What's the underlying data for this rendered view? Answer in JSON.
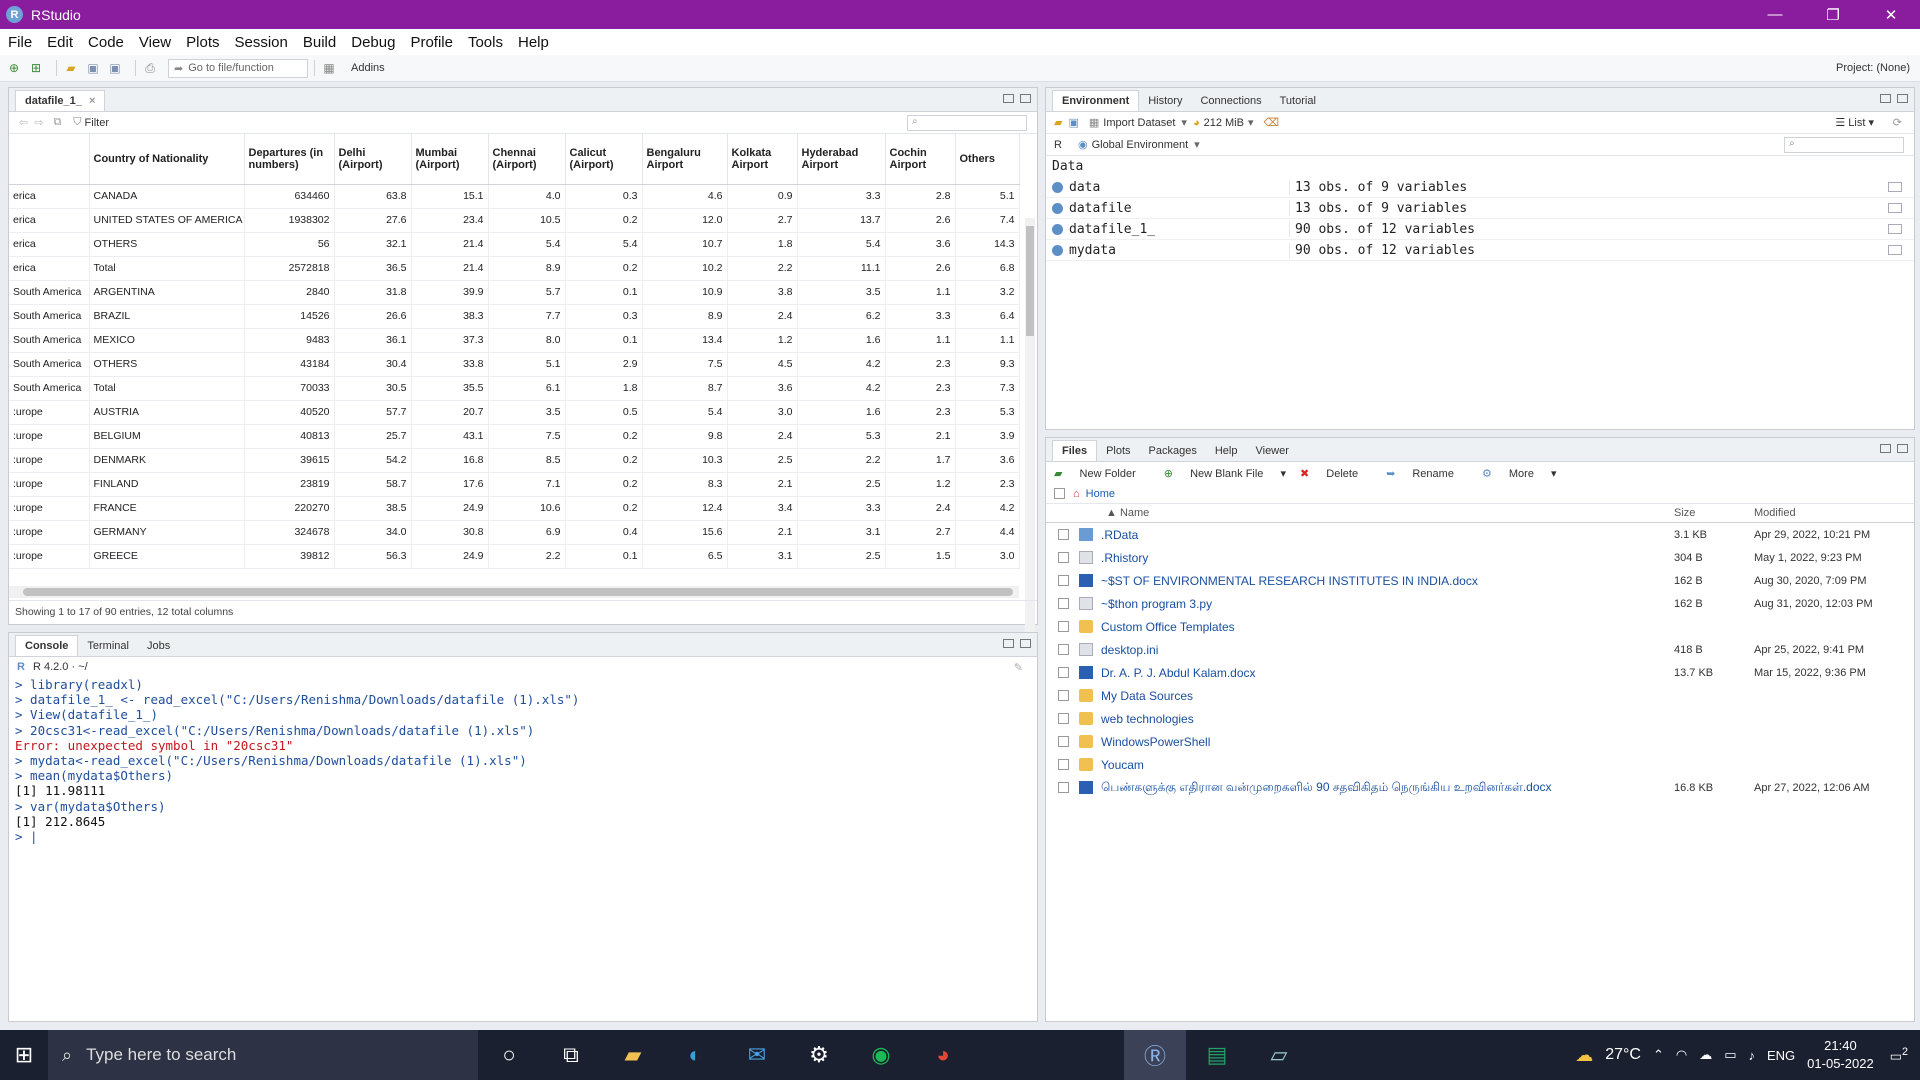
{
  "window": {
    "title": "RStudio",
    "controls": [
      "—",
      "❐",
      "✕"
    ]
  },
  "menu": [
    "File",
    "Edit",
    "Code",
    "View",
    "Plots",
    "Session",
    "Build",
    "Debug",
    "Profile",
    "Tools",
    "Help"
  ],
  "toolbar": {
    "goto_placeholder": "Go to file/function",
    "addins": "Addins",
    "project": "Project: (None)"
  },
  "viewer": {
    "tab": "datafile_1_",
    "filter": "Filter",
    "columns": [
      "",
      "Country of Nationality",
      "Departures (in numbers)",
      "Delhi (Airport)",
      "Mumbai (Airport)",
      "Chennai (Airport)",
      "Calicut (Airport)",
      "Bengaluru Airport",
      "Kolkata Airport",
      "Hyderabad Airport",
      "Cochin Airport",
      "Others"
    ],
    "rows": [
      [
        "erica",
        "CANADA",
        "634460",
        "63.8",
        "15.1",
        "4.0",
        "0.3",
        "4.6",
        "0.9",
        "3.3",
        "2.8",
        "5.1"
      ],
      [
        "erica",
        "UNITED STATES OF AMERICA",
        "1938302",
        "27.6",
        "23.4",
        "10.5",
        "0.2",
        "12.0",
        "2.7",
        "13.7",
        "2.6",
        "7.4"
      ],
      [
        "erica",
        "OTHERS",
        "56",
        "32.1",
        "21.4",
        "5.4",
        "5.4",
        "10.7",
        "1.8",
        "5.4",
        "3.6",
        "14.3"
      ],
      [
        "erica",
        "Total",
        "2572818",
        "36.5",
        "21.4",
        "8.9",
        "0.2",
        "10.2",
        "2.2",
        "11.1",
        "2.6",
        "6.8"
      ],
      [
        "South America",
        "ARGENTINA",
        "2840",
        "31.8",
        "39.9",
        "5.7",
        "0.1",
        "10.9",
        "3.8",
        "3.5",
        "1.1",
        "3.2"
      ],
      [
        "South America",
        "BRAZIL",
        "14526",
        "26.6",
        "38.3",
        "7.7",
        "0.3",
        "8.9",
        "2.4",
        "6.2",
        "3.3",
        "6.4"
      ],
      [
        "South America",
        "MEXICO",
        "9483",
        "36.1",
        "37.3",
        "8.0",
        "0.1",
        "13.4",
        "1.2",
        "1.6",
        "1.1",
        "1.1"
      ],
      [
        "South America",
        "OTHERS",
        "43184",
        "30.4",
        "33.8",
        "5.1",
        "2.9",
        "7.5",
        "4.5",
        "4.2",
        "2.3",
        "9.3"
      ],
      [
        "South America",
        "Total",
        "70033",
        "30.5",
        "35.5",
        "6.1",
        "1.8",
        "8.7",
        "3.6",
        "4.2",
        "2.3",
        "7.3"
      ],
      [
        ":urope",
        "AUSTRIA",
        "40520",
        "57.7",
        "20.7",
        "3.5",
        "0.5",
        "5.4",
        "3.0",
        "1.6",
        "2.3",
        "5.3"
      ],
      [
        ":urope",
        "BELGIUM",
        "40813",
        "25.7",
        "43.1",
        "7.5",
        "0.2",
        "9.8",
        "2.4",
        "5.3",
        "2.1",
        "3.9"
      ],
      [
        ":urope",
        "DENMARK",
        "39615",
        "54.2",
        "16.8",
        "8.5",
        "0.2",
        "10.3",
        "2.5",
        "2.2",
        "1.7",
        "3.6"
      ],
      [
        ":urope",
        "FINLAND",
        "23819",
        "58.7",
        "17.6",
        "7.1",
        "0.2",
        "8.3",
        "2.1",
        "2.5",
        "1.2",
        "2.3"
      ],
      [
        ":urope",
        "FRANCE",
        "220270",
        "38.5",
        "24.9",
        "10.6",
        "0.2",
        "12.4",
        "3.4",
        "3.3",
        "2.4",
        "4.2"
      ],
      [
        ":urope",
        "GERMANY",
        "324678",
        "34.0",
        "30.8",
        "6.9",
        "0.4",
        "15.6",
        "2.1",
        "3.1",
        "2.7",
        "4.4"
      ],
      [
        ":urope",
        "GREECE",
        "39812",
        "56.3",
        "24.9",
        "2.2",
        "0.1",
        "6.5",
        "3.1",
        "2.5",
        "1.5",
        "3.0"
      ]
    ],
    "footer": "Showing 1 to 17 of 90 entries, 12 total columns"
  },
  "console": {
    "tabs": [
      "Console",
      "Terminal",
      "Jobs"
    ],
    "version": "R 4.2.0 · ~/",
    "lines": [
      {
        "type": "in",
        "text": "> library(readxl)"
      },
      {
        "type": "in",
        "text": "> datafile_1_ <- read_excel(\"C:/Users/Renishma/Downloads/datafile (1).xls\")"
      },
      {
        "type": "in",
        "text": "> View(datafile_1_)"
      },
      {
        "type": "in",
        "text": "> 20csc31<-read_excel(\"C:/Users/Renishma/Downloads/datafile (1).xls\")"
      },
      {
        "type": "err",
        "text": "Error: unexpected symbol in \"20csc31\""
      },
      {
        "type": "in",
        "text": "> mydata<-read_excel(\"C:/Users/Renishma/Downloads/datafile (1).xls\")"
      },
      {
        "type": "in",
        "text": "> mean(mydata$Others)"
      },
      {
        "type": "out",
        "text": "[1] 11.98111"
      },
      {
        "type": "in",
        "text": "> var(mydata$Others)"
      },
      {
        "type": "out",
        "text": "[1] 212.8645"
      },
      {
        "type": "in",
        "text": "> |"
      }
    ]
  },
  "environment": {
    "tabs": [
      "Environment",
      "History",
      "Connections",
      "Tutorial"
    ],
    "import_label": "Import Dataset",
    "memory": "212 MiB",
    "view_mode": "List",
    "lang": "R",
    "scope": "Global Environment",
    "section": "Data",
    "items": [
      {
        "name": "data",
        "value": "13 obs. of 9 variables"
      },
      {
        "name": "datafile",
        "value": "13 obs. of 9 variables"
      },
      {
        "name": "datafile_1_",
        "value": "90 obs. of 12 variables"
      },
      {
        "name": "mydata",
        "value": "90 obs. of 12 variables"
      }
    ]
  },
  "files": {
    "tabs": [
      "Files",
      "Plots",
      "Packages",
      "Help",
      "Viewer"
    ],
    "toolbar": [
      "New Folder",
      "New Blank File",
      "Delete",
      "Rename",
      "More"
    ],
    "path": "Home",
    "headers": {
      "name": "Name",
      "size": "Size",
      "modified": "Modified"
    },
    "items": [
      {
        "name": ".RData",
        "size": "3.1 KB",
        "modified": "Apr 29, 2022, 10:21 PM",
        "icon": "r"
      },
      {
        "name": ".Rhistory",
        "size": "304 B",
        "modified": "May 1, 2022, 9:23 PM",
        "icon": "file"
      },
      {
        "name": "~$ST OF ENVIRONMENTAL RESEARCH INSTITUTES IN INDIA.docx",
        "size": "162 B",
        "modified": "Aug 30, 2020, 7:09 PM",
        "icon": "word"
      },
      {
        "name": "~$thon program 3.py",
        "size": "162 B",
        "modified": "Aug 31, 2020, 12:03 PM",
        "icon": "file"
      },
      {
        "name": "Custom Office Templates",
        "size": "",
        "modified": "",
        "icon": "folder"
      },
      {
        "name": "desktop.ini",
        "size": "418 B",
        "modified": "Apr 25, 2022, 9:41 PM",
        "icon": "file"
      },
      {
        "name": "Dr. A. P. J. Abdul Kalam.docx",
        "size": "13.7 KB",
        "modified": "Mar 15, 2022, 9:36 PM",
        "icon": "word"
      },
      {
        "name": "My Data Sources",
        "size": "",
        "modified": "",
        "icon": "folder"
      },
      {
        "name": "web technologies",
        "size": "",
        "modified": "",
        "icon": "folder"
      },
      {
        "name": "WindowsPowerShell",
        "size": "",
        "modified": "",
        "icon": "folder"
      },
      {
        "name": "Youcam",
        "size": "",
        "modified": "",
        "icon": "folder"
      },
      {
        "name": "பெண்களுக்கு எதிரான வன்முறைகளில் 90 சதவிகிதம் நெருங்கிய உறவினர்கள்.docx",
        "size": "16.8 KB",
        "modified": "Apr 27, 2022, 12:06 AM",
        "icon": "word"
      }
    ]
  },
  "taskbar": {
    "search_placeholder": "Type here to search",
    "weather": "27°C",
    "lang": "ENG",
    "time": "21:40",
    "date": "01-05-2022",
    "notifications": "2"
  }
}
